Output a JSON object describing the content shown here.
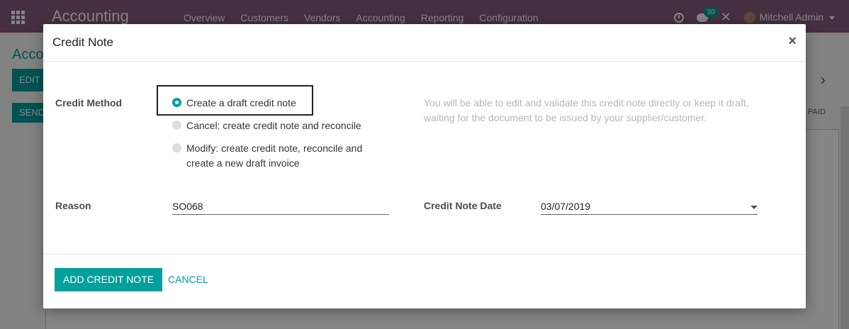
{
  "app": {
    "brand": "Accounting",
    "menu": [
      "Overview",
      "Customers",
      "Vendors",
      "Accounting",
      "Reporting",
      "Configuration"
    ],
    "messages_count": "30",
    "user": "Mitchell Admin"
  },
  "background": {
    "title": "Acco",
    "edit_label": "EDIT",
    "send_label": "SEND",
    "paid_label": "PAID",
    "next_icon": "chevron-right-icon"
  },
  "dialog": {
    "title": "Credit Note",
    "close_symbol": "×",
    "credit_method_label": "Credit Method",
    "options": [
      {
        "label": "Create a draft credit note",
        "selected": true
      },
      {
        "label": "Cancel: create credit note and reconcile",
        "selected": false
      },
      {
        "label": "Modify: create credit note, reconcile and create a new draft invoice",
        "selected": false
      }
    ],
    "help_text": "You will be able to edit and validate this credit note directly or keep it draft, waiting for the document to be issued by your supplier/customer.",
    "reason_label": "Reason",
    "reason_value": "SO068",
    "date_label": "Credit Note Date",
    "date_value": "03/07/2019",
    "primary_button": "ADD CREDIT NOTE",
    "cancel_button": "CANCEL"
  },
  "colors": {
    "brand": "#875a7b",
    "accent": "#00a09d"
  }
}
